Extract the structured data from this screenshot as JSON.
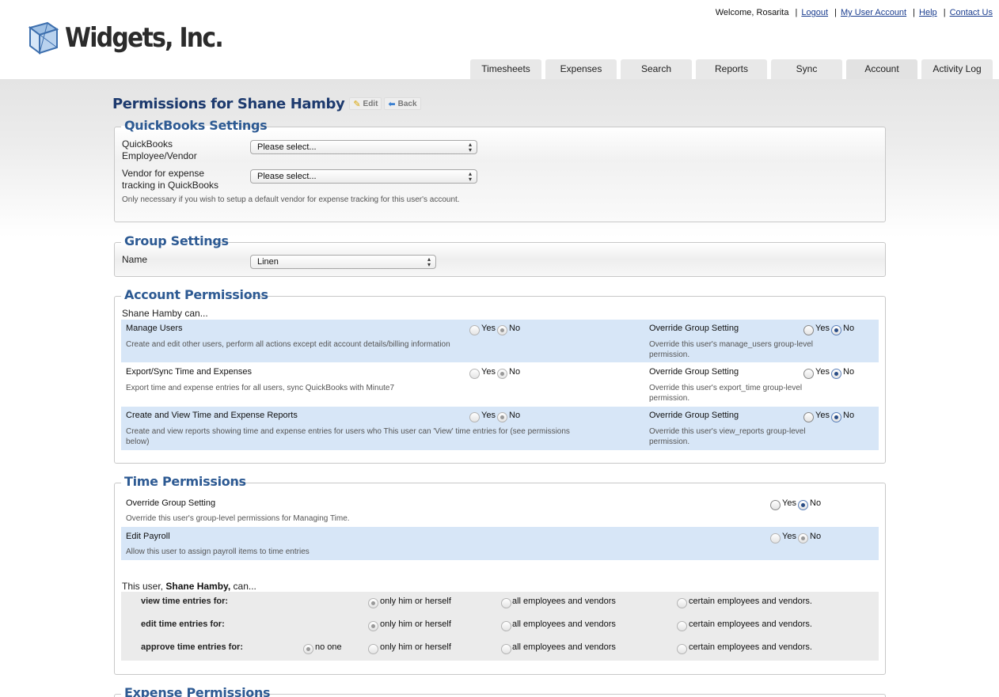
{
  "header": {
    "brand": "Widgets, Inc.",
    "welcome": "Welcome, Rosarita",
    "links": [
      "Logout",
      "My User Account",
      "Help",
      "Contact Us"
    ],
    "tabs": [
      "Timesheets",
      "Expenses",
      "Search",
      "Reports",
      "Sync",
      "Account",
      "Activity Log"
    ],
    "active_tab": "Account"
  },
  "page": {
    "title": "Permissions for Shane Hamby",
    "edit_label": "Edit",
    "back_label": "Back"
  },
  "quickbooks": {
    "legend": "QuickBooks Settings",
    "employee_label_1": "QuickBooks",
    "employee_label_2": "Employee/Vendor",
    "employee_value": "Please select...",
    "vendor_label_1": "Vendor for expense",
    "vendor_label_2": "tracking in QuickBooks",
    "vendor_value": "Please select...",
    "hint": "Only necessary if you wish to setup a default vendor for expense tracking for this user's account."
  },
  "group": {
    "legend": "Group Settings",
    "name_label": "Name",
    "name_value": "Linen"
  },
  "account": {
    "legend": "Account Permissions",
    "intro": "Shane Hamby can...",
    "yes": "Yes",
    "no": "No",
    "override_title": "Override Group Setting",
    "rows": [
      {
        "title": "Manage Users",
        "desc": "Create and edit other users, perform all actions except edit account details/billing information",
        "override_desc_1": "Override this user's manage_users group-level",
        "override_desc_2": "permission."
      },
      {
        "title": "Export/Sync Time and Expenses",
        "desc": "Export time and expense entries for all users, sync QuickBooks with Minute7",
        "override_desc_1": "Override this user's export_time group-level",
        "override_desc_2": "permission."
      },
      {
        "title": "Create and View Time and Expense Reports",
        "desc_1": "Create and view reports showing time and expense entries for users who This user can 'View' time entries for (see permissions",
        "desc_2": "below)",
        "override_desc_1": "Override this user's view_reports group-level",
        "override_desc_2": "permission."
      }
    ]
  },
  "time": {
    "legend": "Time Permissions",
    "yes": "Yes",
    "no": "No",
    "override": {
      "title": "Override Group Setting",
      "desc": "Override this user's group-level permissions for Managing Time."
    },
    "payroll": {
      "title": "Edit Payroll",
      "desc": "Allow this user to assign payroll items to time entries"
    },
    "user_intro_pre": "This user,",
    "user_intro_name": "Shane Hamby,",
    "user_intro_post": "can...",
    "view_label": "view time entries for:",
    "edit_label": "edit time entries for:",
    "approve_label": "approve time entries for:",
    "opt_none": "no one",
    "opt_self": "only him or herself",
    "opt_all": "all employees and vendors",
    "opt_certain": "certain employees and vendors."
  },
  "expense": {
    "legend": "Expense Permissions"
  }
}
